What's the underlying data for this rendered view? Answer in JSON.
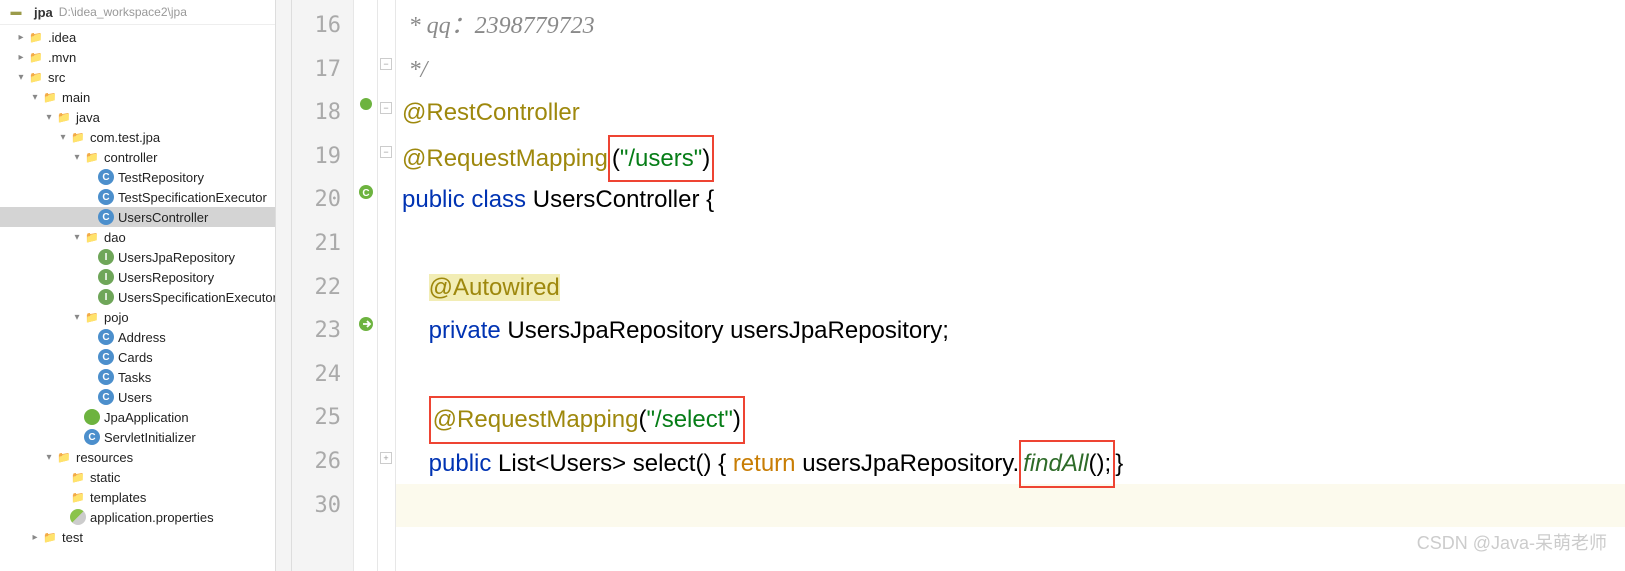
{
  "project": {
    "name": "jpa",
    "path": "D:\\idea_workspace2\\jpa"
  },
  "tree": {
    "idea": ".idea",
    "mvn": ".mvn",
    "src": "src",
    "main": "main",
    "java": "java",
    "pkg": "com.test.jpa",
    "controller": "controller",
    "testRepo": "TestRepository",
    "testSpecExec": "TestSpecificationExecutor",
    "usersCtrl": "UsersController",
    "dao": "dao",
    "usersJpaRepo": "UsersJpaRepository",
    "usersRepo": "UsersRepository",
    "usersSpecExec": "UsersSpecificationExecutor",
    "pojo": "pojo",
    "address": "Address",
    "cards": "Cards",
    "tasks": "Tasks",
    "users": "Users",
    "jpaApp": "JpaApplication",
    "servletInit": "ServletInitializer",
    "resources": "resources",
    "static": "static",
    "templates": "templates",
    "appProps": "application.properties",
    "test": "test"
  },
  "lineNumbers": [
    "16",
    "17",
    "18",
    "19",
    "20",
    "21",
    "22",
    "23",
    "24",
    "25",
    "26",
    "30"
  ],
  "code": {
    "l16": "* qq：2398779723",
    "l17": "*/",
    "l18": "@RestController",
    "l19a": "@RequestMapping",
    "l19b": "(\"/users\")",
    "l20_kw": "public class ",
    "l20_id": "UsersController {",
    "l22": "@Autowired",
    "l23_kw": "private ",
    "l23_type": "UsersJpaRepository ",
    "l23_var": "usersJpaRepository;",
    "l25a": "@RequestMapping",
    "l25b": "(",
    "l25c": "\"/select\"",
    "l25d": ")",
    "l26_kw": "public ",
    "l26_type": "List<Users> ",
    "l26_name": "select",
    "l26_paren": "() { ",
    "l26_ret": "return ",
    "l26_var": "usersJpaRepository.",
    "l26_method": "findAll",
    "l26_end": "(); ",
    "l26_brace": "}"
  },
  "watermark": "CSDN @Java-呆萌老师"
}
